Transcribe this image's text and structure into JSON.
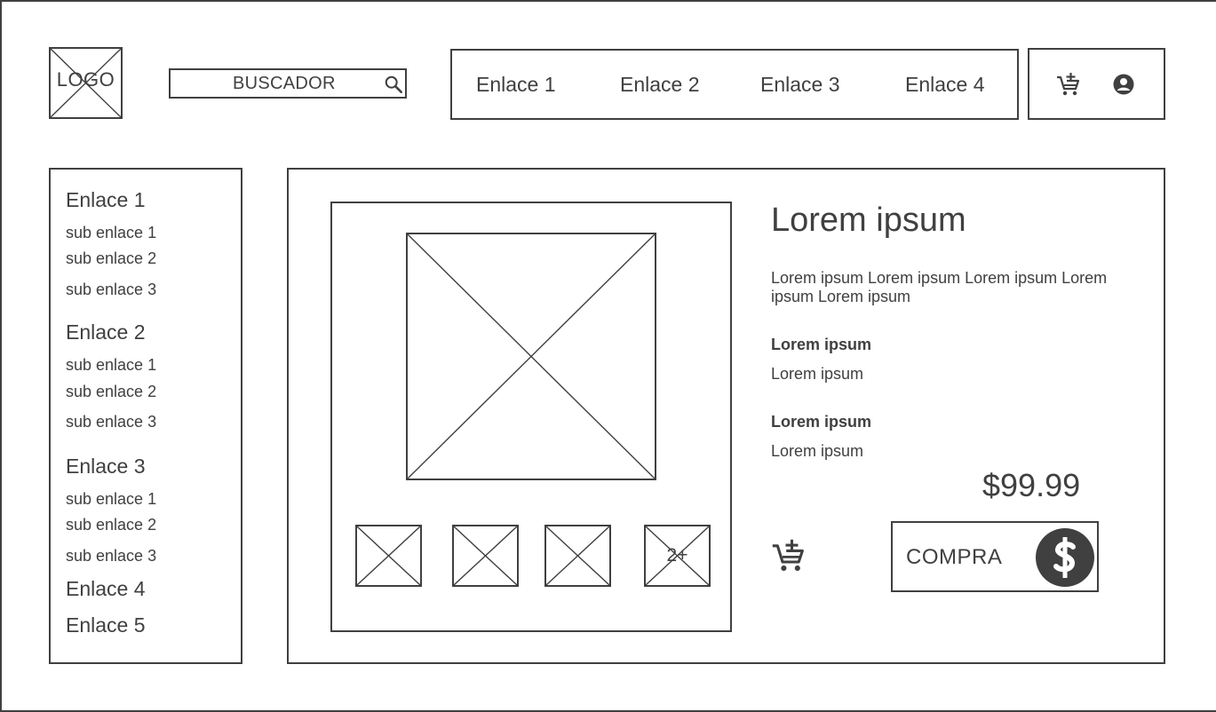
{
  "header": {
    "logo_text": "LOGO",
    "search_label": "BUSCADOR",
    "nav_links": [
      "Enlace 1",
      "Enlace 2",
      "Enlace 3",
      "Enlace 4"
    ],
    "icons": [
      "add-to-cart-icon",
      "user-icon",
      "search-icon"
    ]
  },
  "sidebar": {
    "sections": [
      {
        "label": "Enlace 1",
        "subitems": [
          "sub enlace 1",
          "sub enlace 2",
          "sub enlace 3"
        ]
      },
      {
        "label": "Enlace 2",
        "subitems": [
          "sub enlace 1",
          "sub enlace 2",
          "sub enlace 3"
        ]
      },
      {
        "label": "Enlace 3",
        "subitems": [
          "sub enlace 1",
          "sub enlace 2",
          "sub enlace 3"
        ]
      },
      {
        "label": "Enlace 4",
        "subitems": []
      },
      {
        "label": "Enlace 5",
        "subitems": []
      }
    ]
  },
  "product": {
    "title": "Lorem ipsum",
    "description": "Lorem ipsum Lorem ipsum Lorem ipsum Lorem ipsum Lorem ipsum",
    "specs": [
      {
        "label": "Lorem ipsum",
        "value": "Lorem ipsum"
      },
      {
        "label": "Lorem ipsum",
        "value": "Lorem ipsum"
      }
    ],
    "price": "$99.99",
    "buy_label": "COMPRA",
    "more_images_label": "2+",
    "icons": [
      "add-to-cart-icon",
      "dollar-icon"
    ]
  },
  "colors": {
    "stroke": "#404040",
    "background": "#ffffff"
  }
}
